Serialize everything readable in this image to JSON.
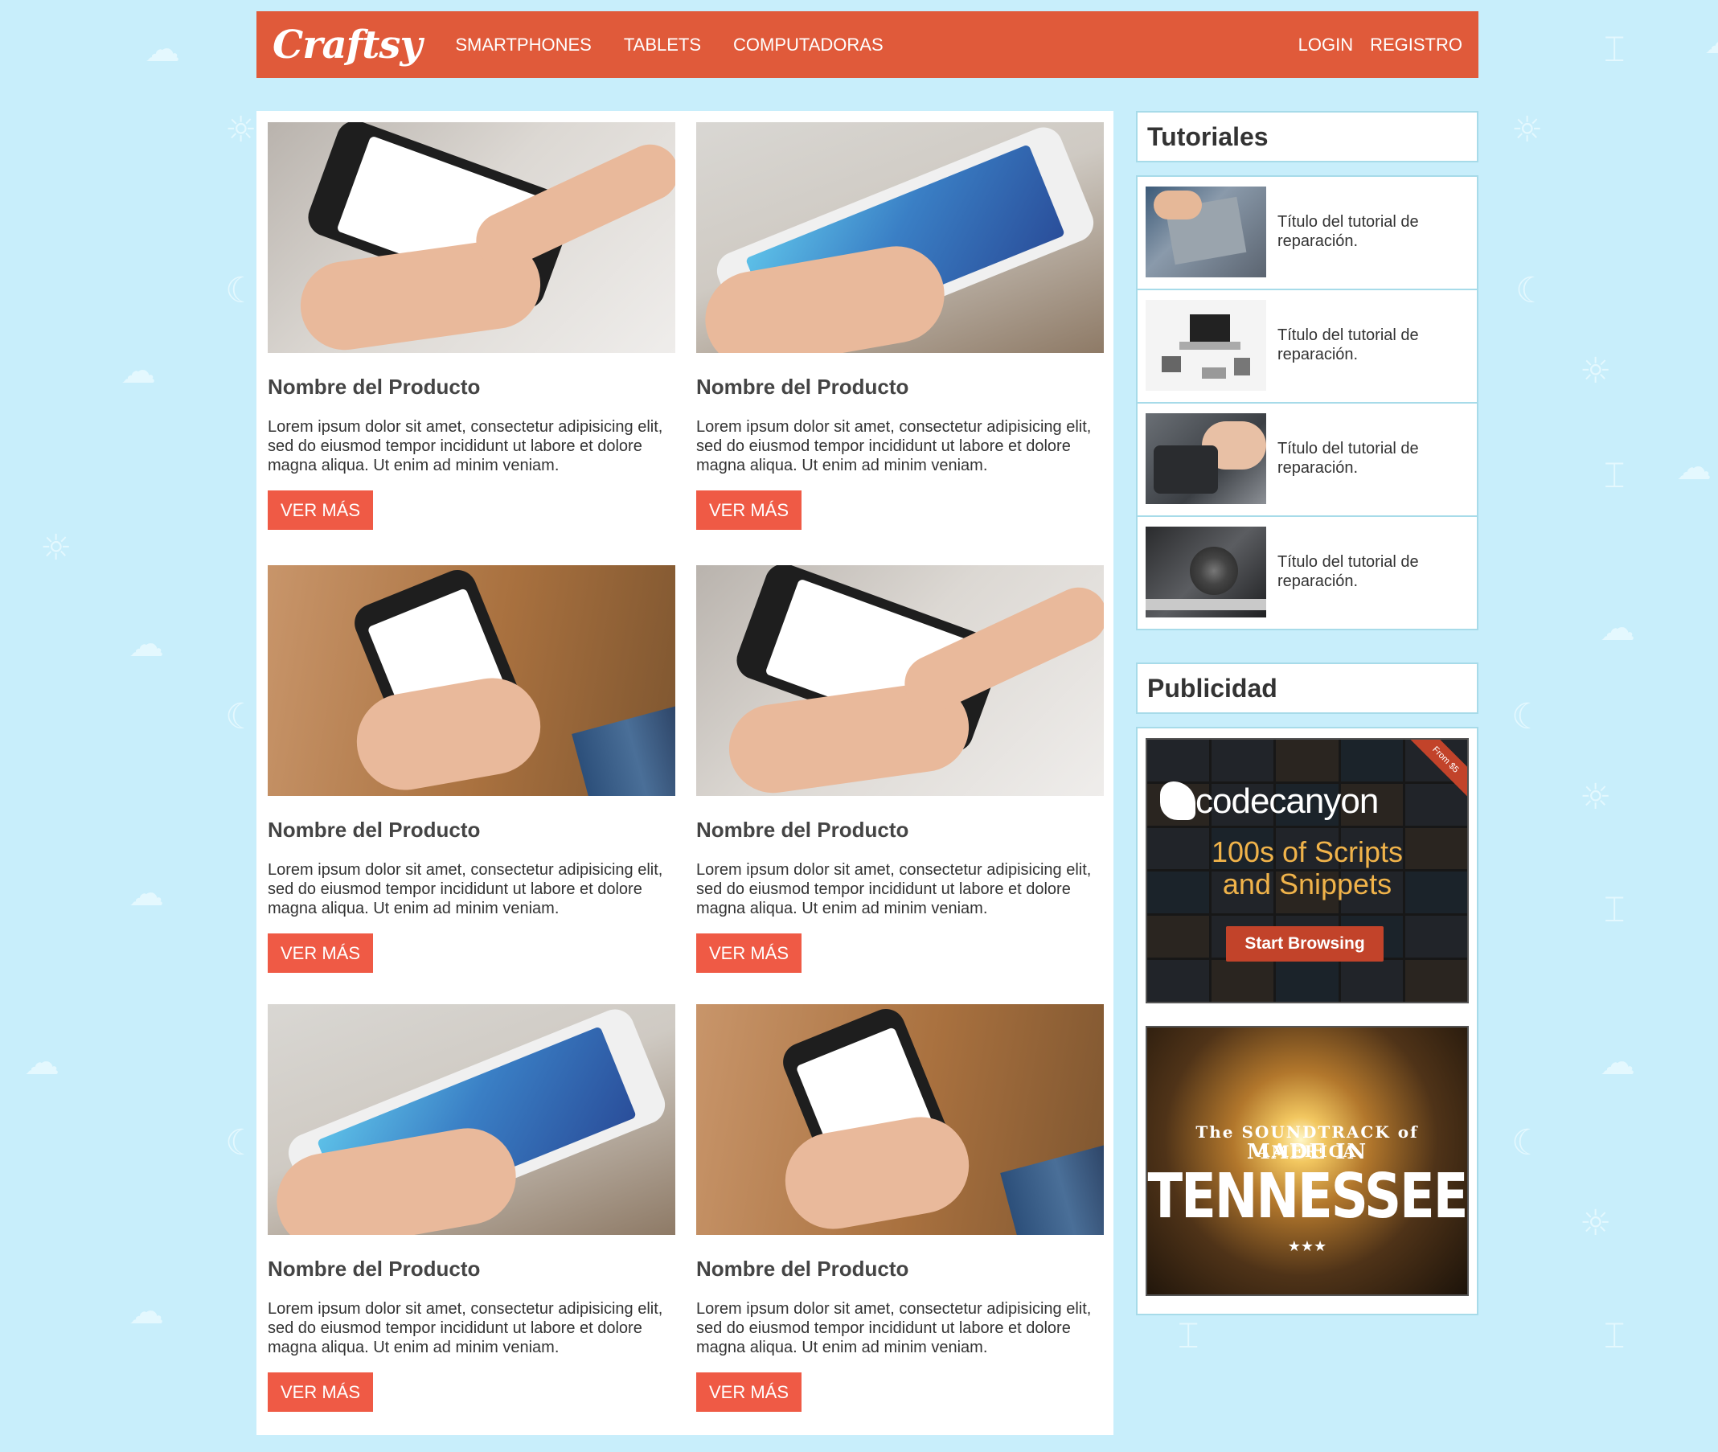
{
  "nav": {
    "logo": "Craftsy",
    "links": [
      "SMARTPHONES",
      "TABLETS",
      "COMPUTADORAS"
    ],
    "login": "LOGIN",
    "register": "REGISTRO"
  },
  "products": [
    {
      "name": "Nombre del Producto",
      "description": "Lorem ipsum dolor sit amet, consectetur adipisicing elit, sed do eiusmod tempor incididunt ut labore et dolore magna aliqua. Ut enim ad minim veniam.",
      "button": "VER MÁS"
    },
    {
      "name": "Nombre del Producto",
      "description": "Lorem ipsum dolor sit amet, consectetur adipisicing elit, sed do eiusmod tempor incididunt ut labore et dolore magna aliqua. Ut enim ad minim veniam.",
      "button": "VER MÁS"
    },
    {
      "name": "Nombre del Producto",
      "description": "Lorem ipsum dolor sit amet, consectetur adipisicing elit, sed do eiusmod tempor incididunt ut labore et dolore magna aliqua. Ut enim ad minim veniam.",
      "button": "VER MÁS"
    },
    {
      "name": "Nombre del Producto",
      "description": "Lorem ipsum dolor sit amet, consectetur adipisicing elit, sed do eiusmod tempor incididunt ut labore et dolore magna aliqua. Ut enim ad minim veniam.",
      "button": "VER MÁS"
    },
    {
      "name": "Nombre del Producto",
      "description": "Lorem ipsum dolor sit amet, consectetur adipisicing elit, sed do eiusmod tempor incididunt ut labore et dolore magna aliqua. Ut enim ad minim veniam.",
      "button": "VER MÁS"
    },
    {
      "name": "Nombre del Producto",
      "description": "Lorem ipsum dolor sit amet, consectetur adipisicing elit, sed do eiusmod tempor incididunt ut labore et dolore magna aliqua. Ut enim ad minim veniam.",
      "button": "VER MÁS"
    }
  ],
  "tutorials": {
    "title": "Tutoriales",
    "items": [
      {
        "label": "Título del tutorial de reparación."
      },
      {
        "label": "Título del tutorial de reparación."
      },
      {
        "label": "Título del tutorial de reparación."
      },
      {
        "label": "Título del tutorial de reparación."
      }
    ]
  },
  "ads": {
    "title": "Publicidad",
    "codecanyon": {
      "brand": "codecanyon",
      "tagline_1": "100s of Scripts",
      "tagline_2": "and Snippets",
      "button": "Start Browsing",
      "corner": "From $5"
    },
    "tennessee": {
      "top": "The SOUNDTRACK of AMERICA",
      "middle": "MADE IN",
      "main": "TENNESSEE",
      "stars": "★★★"
    }
  },
  "colors": {
    "background": "#c8eefb",
    "navbar": "#e05a3a",
    "button": "#ef5a45",
    "border": "#a7dbe9"
  }
}
